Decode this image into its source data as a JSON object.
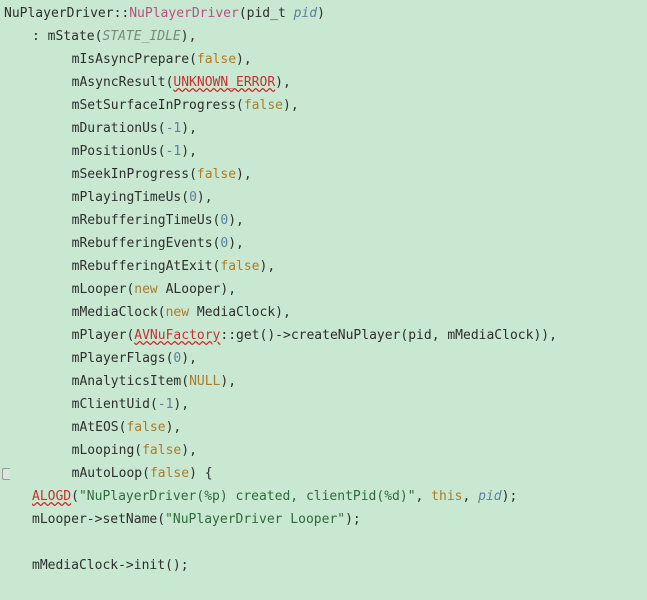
{
  "decl": {
    "class_name": "NuPlayerDriver",
    "sep": "::",
    "method_name": "NuPlayerDriver",
    "param_type": "pid_t",
    "param_name": "pid"
  },
  "inits": [
    {
      "prefix": ": ",
      "name": "mState",
      "args": [
        {
          "t": "enum",
          "v": "STATE_IDLE"
        }
      ]
    },
    {
      "prefix": "  ",
      "name": "mIsAsyncPrepare",
      "args": [
        {
          "t": "bool",
          "v": "false"
        }
      ]
    },
    {
      "prefix": "  ",
      "name": "mAsyncResult",
      "args": [
        {
          "t": "err",
          "v": "UNKNOWN_ERROR"
        }
      ]
    },
    {
      "prefix": "  ",
      "name": "mSetSurfaceInProgress",
      "args": [
        {
          "t": "bool",
          "v": "false"
        }
      ]
    },
    {
      "prefix": "  ",
      "name": "mDurationUs",
      "args": [
        {
          "t": "num",
          "v": "-1"
        }
      ]
    },
    {
      "prefix": "  ",
      "name": "mPositionUs",
      "args": [
        {
          "t": "num",
          "v": "-1"
        }
      ]
    },
    {
      "prefix": "  ",
      "name": "mSeekInProgress",
      "args": [
        {
          "t": "bool",
          "v": "false"
        }
      ]
    },
    {
      "prefix": "  ",
      "name": "mPlayingTimeUs",
      "args": [
        {
          "t": "num",
          "v": "0"
        }
      ]
    },
    {
      "prefix": "  ",
      "name": "mRebufferingTimeUs",
      "args": [
        {
          "t": "num",
          "v": "0"
        }
      ]
    },
    {
      "prefix": "  ",
      "name": "mRebufferingEvents",
      "args": [
        {
          "t": "num",
          "v": "0"
        }
      ]
    },
    {
      "prefix": "  ",
      "name": "mRebufferingAtExit",
      "args": [
        {
          "t": "bool",
          "v": "false"
        }
      ]
    },
    {
      "prefix": "  ",
      "name": "mLooper",
      "args": [
        {
          "t": "new",
          "v": "new"
        },
        {
          "t": "plain",
          "v": " ALooper"
        }
      ]
    },
    {
      "prefix": "  ",
      "name": "mMediaClock",
      "args": [
        {
          "t": "new",
          "v": "new"
        },
        {
          "t": "plain",
          "v": " MediaClock"
        }
      ]
    },
    {
      "prefix": "  ",
      "name": "mPlayer",
      "args": [
        {
          "t": "err",
          "v": "AVNuFactory"
        },
        {
          "t": "plain",
          "v": "::get()->createNuPlayer(pid, mMediaClock)"
        }
      ]
    },
    {
      "prefix": "  ",
      "name": "mPlayerFlags",
      "args": [
        {
          "t": "num",
          "v": "0"
        }
      ]
    },
    {
      "prefix": "  ",
      "name": "mAnalyticsItem",
      "args": [
        {
          "t": "null",
          "v": "NULL"
        }
      ]
    },
    {
      "prefix": "  ",
      "name": "mClientUid",
      "args": [
        {
          "t": "num",
          "v": "-1"
        }
      ]
    },
    {
      "prefix": "  ",
      "name": "mAtEOS",
      "args": [
        {
          "t": "bool",
          "v": "false"
        }
      ]
    },
    {
      "prefix": "  ",
      "name": "mLooping",
      "args": [
        {
          "t": "bool",
          "v": "false"
        }
      ]
    },
    {
      "prefix": "  ",
      "name": "mAutoLoop",
      "args": [
        {
          "t": "bool",
          "v": "false"
        }
      ],
      "trailing": " {"
    }
  ],
  "body": {
    "alogd": {
      "fn": "ALOGD",
      "fmt": "\"NuPlayerDriver(%p) created, clientPid(%d)\"",
      "arg1": "this",
      "arg2": "pid"
    },
    "setname": {
      "obj": "mLooper",
      "arrow": "->",
      "fn": "setName",
      "arg": "\"NuPlayerDriver Looper\""
    },
    "initcall": {
      "obj": "mMediaClock",
      "arrow": "->",
      "fn": "init",
      "args": "()"
    }
  }
}
